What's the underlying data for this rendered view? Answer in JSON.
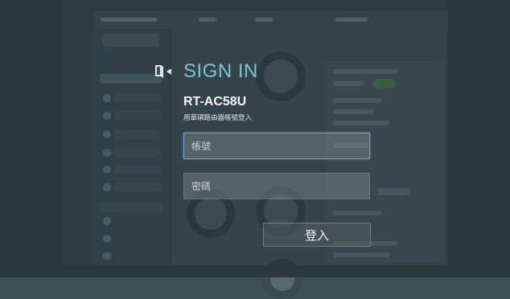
{
  "dialog": {
    "title": "SIGN IN",
    "model": "RT-AC58U",
    "description": "用華碩路由器帳號登入",
    "icon": "sign-in-door-icon",
    "accent_color": "#7ec2d6"
  },
  "form": {
    "username_placeholder": "帳號",
    "username_value": "",
    "password_placeholder": "密碼",
    "password_value": "",
    "submit_label": "登入"
  }
}
